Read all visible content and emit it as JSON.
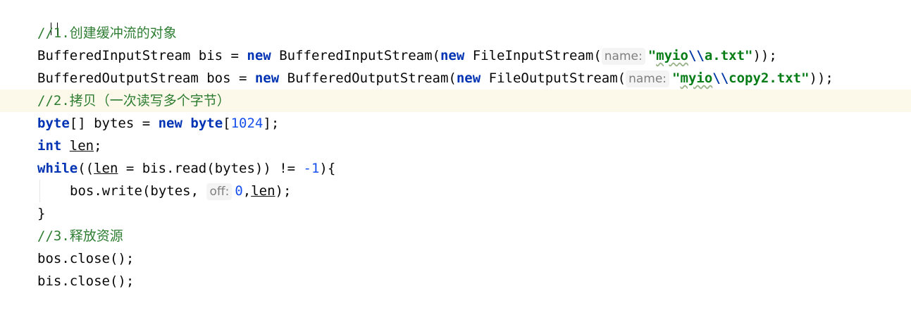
{
  "code": {
    "l1_comment": "//1.创建缓冲流的对象",
    "l2": {
      "type": "BufferedInputStream",
      "var": " bis = ",
      "kw_new": "new",
      "ctor": " BufferedInputStream(",
      "kw_new2": "new",
      "ctor2": " FileInputStream(",
      "hint": "name:",
      "str_a": "\"",
      "str_b": "myio",
      "str_c": "\\\\",
      "str_d": "a.txt\"",
      "tail": "));"
    },
    "l3": {
      "type": "BufferedOutputStream",
      "var": " bos = ",
      "kw_new": "new",
      "ctor": " BufferedOutputStream(",
      "kw_new2": "new",
      "ctor2": " FileOutputStream(",
      "hint": "name:",
      "str_a": "\"",
      "str_b": "myio",
      "str_c": "\\\\",
      "str_d": "copy2.txt\"",
      "tail": "));"
    },
    "l4_comment": "//2.拷贝（一次读写多个字节）",
    "l5": {
      "kw_byte": "byte",
      "mid": "[] bytes = ",
      "kw_new": "new",
      "sp": " ",
      "kw_byte2": "byte",
      "open": "[",
      "num": "1024",
      "close": "];"
    },
    "l6": {
      "kw": "int",
      "sp": " ",
      "var": "len",
      "end": ";"
    },
    "l7": {
      "kw": "while",
      "a": "((",
      "var": "len",
      "b": " = bis.read(bytes)) != ",
      "num": "-1",
      "c": "){"
    },
    "l8": {
      "a": "bos.write(bytes, ",
      "hint": "off:",
      "num": "0",
      "b": ",",
      "var": "len",
      "c": ");"
    },
    "l9": "}",
    "l10_comment": "//3.释放资源",
    "l11": "bos.close();",
    "l12": "bis.close();"
  },
  "colors": {
    "keyword": "#0033b3",
    "comment": "#2e7d32",
    "string": "#067d17",
    "number": "#1750eb",
    "current_line": "#fcf9ea"
  }
}
